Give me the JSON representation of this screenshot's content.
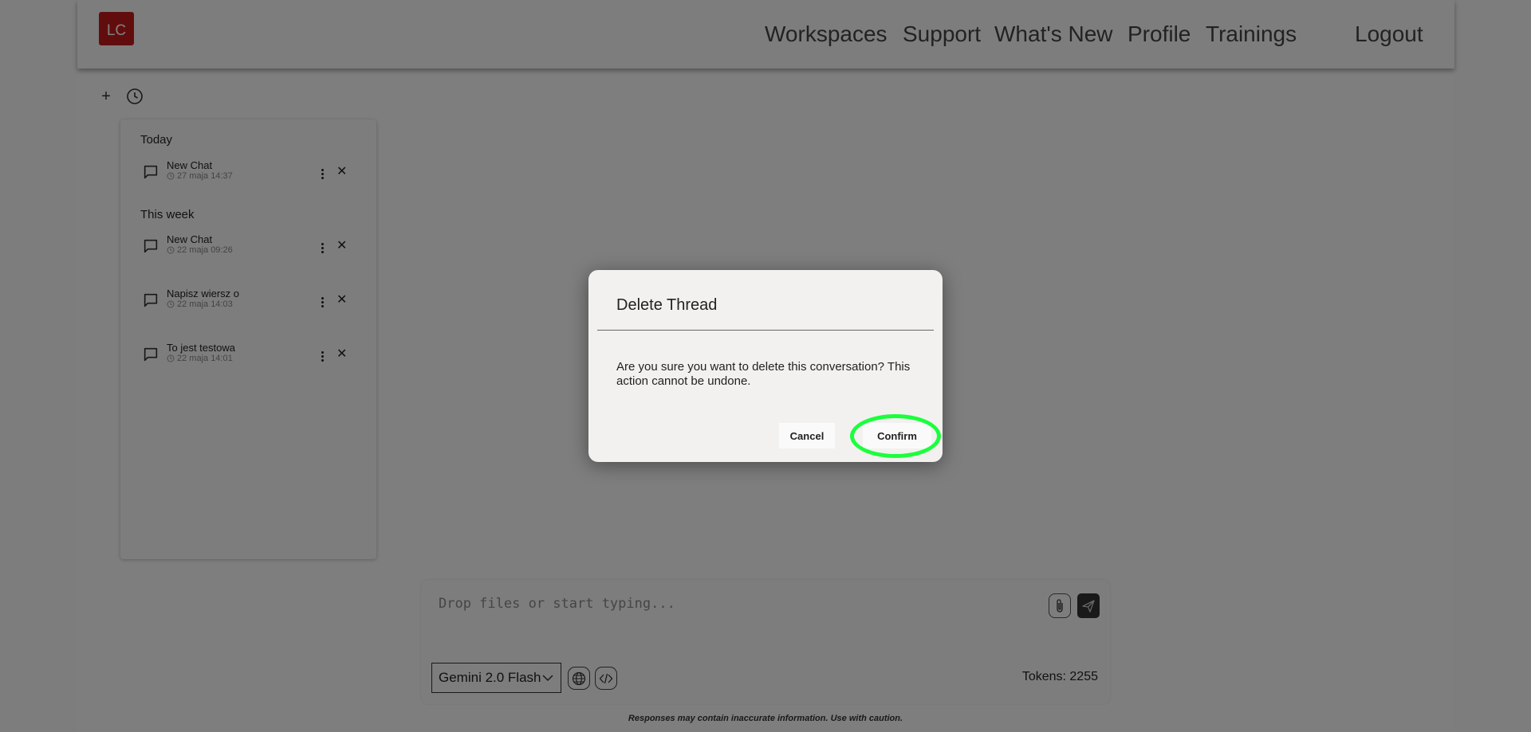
{
  "header": {
    "logo_text": "LC",
    "logo_color": "#c51b1b",
    "nav": [
      "Workspaces",
      "Support",
      "What's New",
      "Profile",
      "Trainings"
    ],
    "logout": "Logout"
  },
  "sidebar": {
    "tools": [
      "plus-icon",
      "history-icon"
    ],
    "groups": [
      {
        "title": "Today",
        "items": [
          {
            "name": "New Chat",
            "date": "27 maja 14:37"
          }
        ]
      },
      {
        "title": "This week",
        "items": [
          {
            "name": "New Chat",
            "date": "22 maja 09:26"
          },
          {
            "name": "Napisz wiersz o",
            "date": "22 maja 14:03"
          },
          {
            "name": "To jest testowa",
            "date": "22 maja 14:01"
          }
        ]
      }
    ]
  },
  "composer": {
    "placeholder": "Drop files or start typing...",
    "model": "Gemini 2.0 Flash",
    "tokens": "Tokens: 2255"
  },
  "disclaimer": "Responses may contain inaccurate information. Use with caution.",
  "dialog": {
    "title": "Delete Thread",
    "message": "Are you sure you want to delete this conversation? This action cannot be undone.",
    "cancel": "Cancel",
    "confirm": "Confirm",
    "highlight_color": "#1aff3c"
  }
}
